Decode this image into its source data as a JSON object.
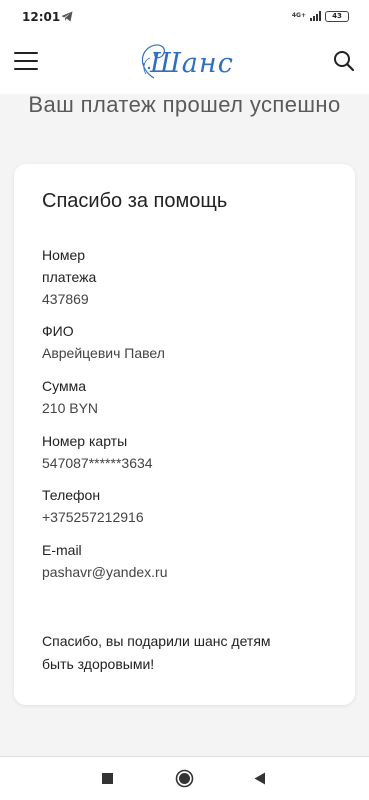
{
  "status_bar": {
    "time": "12:01",
    "network": "4G+",
    "battery": "43"
  },
  "header": {
    "logo_text": "Шанс"
  },
  "page": {
    "heading": "Ваш платеж прошел успешно"
  },
  "card": {
    "title": "Спасибо за помощь",
    "fields": [
      {
        "label": "Номер платежа",
        "value": "437869"
      },
      {
        "label": "ФИО",
        "value": "Аврейцевич Павел"
      },
      {
        "label": "Сумма",
        "value": "210 BYN"
      },
      {
        "label": "Номер карты",
        "value": "547087******3634"
      },
      {
        "label": "Телефон",
        "value": "+375257212916"
      },
      {
        "label": "E-mail",
        "value": "pashavr@yandex.ru"
      }
    ],
    "thanks_message": "Спасибо, вы подарили шанс детям быть здоровыми!"
  },
  "colors": {
    "brand": "#2f6fbd",
    "background": "#f4f4f4",
    "card": "#ffffff"
  },
  "icons": [
    "telegram-icon",
    "signal-icon",
    "battery-icon",
    "menu-icon",
    "search-icon",
    "nav-recents-icon",
    "nav-home-icon",
    "nav-back-icon"
  ]
}
